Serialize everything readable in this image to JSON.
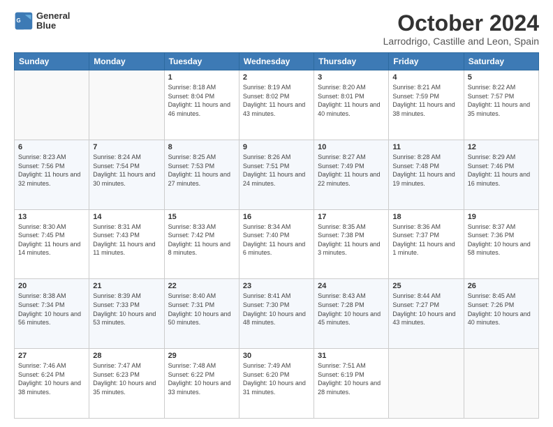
{
  "logo": {
    "line1": "General",
    "line2": "Blue"
  },
  "title": "October 2024",
  "subtitle": "Larrodrigo, Castille and Leon, Spain",
  "days_of_week": [
    "Sunday",
    "Monday",
    "Tuesday",
    "Wednesday",
    "Thursday",
    "Friday",
    "Saturday"
  ],
  "weeks": [
    [
      {
        "day": "",
        "sunrise": "",
        "sunset": "",
        "daylight": ""
      },
      {
        "day": "",
        "sunrise": "",
        "sunset": "",
        "daylight": ""
      },
      {
        "day": "1",
        "sunrise": "Sunrise: 8:18 AM",
        "sunset": "Sunset: 8:04 PM",
        "daylight": "Daylight: 11 hours and 46 minutes."
      },
      {
        "day": "2",
        "sunrise": "Sunrise: 8:19 AM",
        "sunset": "Sunset: 8:02 PM",
        "daylight": "Daylight: 11 hours and 43 minutes."
      },
      {
        "day": "3",
        "sunrise": "Sunrise: 8:20 AM",
        "sunset": "Sunset: 8:01 PM",
        "daylight": "Daylight: 11 hours and 40 minutes."
      },
      {
        "day": "4",
        "sunrise": "Sunrise: 8:21 AM",
        "sunset": "Sunset: 7:59 PM",
        "daylight": "Daylight: 11 hours and 38 minutes."
      },
      {
        "day": "5",
        "sunrise": "Sunrise: 8:22 AM",
        "sunset": "Sunset: 7:57 PM",
        "daylight": "Daylight: 11 hours and 35 minutes."
      }
    ],
    [
      {
        "day": "6",
        "sunrise": "Sunrise: 8:23 AM",
        "sunset": "Sunset: 7:56 PM",
        "daylight": "Daylight: 11 hours and 32 minutes."
      },
      {
        "day": "7",
        "sunrise": "Sunrise: 8:24 AM",
        "sunset": "Sunset: 7:54 PM",
        "daylight": "Daylight: 11 hours and 30 minutes."
      },
      {
        "day": "8",
        "sunrise": "Sunrise: 8:25 AM",
        "sunset": "Sunset: 7:53 PM",
        "daylight": "Daylight: 11 hours and 27 minutes."
      },
      {
        "day": "9",
        "sunrise": "Sunrise: 8:26 AM",
        "sunset": "Sunset: 7:51 PM",
        "daylight": "Daylight: 11 hours and 24 minutes."
      },
      {
        "day": "10",
        "sunrise": "Sunrise: 8:27 AM",
        "sunset": "Sunset: 7:49 PM",
        "daylight": "Daylight: 11 hours and 22 minutes."
      },
      {
        "day": "11",
        "sunrise": "Sunrise: 8:28 AM",
        "sunset": "Sunset: 7:48 PM",
        "daylight": "Daylight: 11 hours and 19 minutes."
      },
      {
        "day": "12",
        "sunrise": "Sunrise: 8:29 AM",
        "sunset": "Sunset: 7:46 PM",
        "daylight": "Daylight: 11 hours and 16 minutes."
      }
    ],
    [
      {
        "day": "13",
        "sunrise": "Sunrise: 8:30 AM",
        "sunset": "Sunset: 7:45 PM",
        "daylight": "Daylight: 11 hours and 14 minutes."
      },
      {
        "day": "14",
        "sunrise": "Sunrise: 8:31 AM",
        "sunset": "Sunset: 7:43 PM",
        "daylight": "Daylight: 11 hours and 11 minutes."
      },
      {
        "day": "15",
        "sunrise": "Sunrise: 8:33 AM",
        "sunset": "Sunset: 7:42 PM",
        "daylight": "Daylight: 11 hours and 8 minutes."
      },
      {
        "day": "16",
        "sunrise": "Sunrise: 8:34 AM",
        "sunset": "Sunset: 7:40 PM",
        "daylight": "Daylight: 11 hours and 6 minutes."
      },
      {
        "day": "17",
        "sunrise": "Sunrise: 8:35 AM",
        "sunset": "Sunset: 7:38 PM",
        "daylight": "Daylight: 11 hours and 3 minutes."
      },
      {
        "day": "18",
        "sunrise": "Sunrise: 8:36 AM",
        "sunset": "Sunset: 7:37 PM",
        "daylight": "Daylight: 11 hours and 1 minute."
      },
      {
        "day": "19",
        "sunrise": "Sunrise: 8:37 AM",
        "sunset": "Sunset: 7:36 PM",
        "daylight": "Daylight: 10 hours and 58 minutes."
      }
    ],
    [
      {
        "day": "20",
        "sunrise": "Sunrise: 8:38 AM",
        "sunset": "Sunset: 7:34 PM",
        "daylight": "Daylight: 10 hours and 56 minutes."
      },
      {
        "day": "21",
        "sunrise": "Sunrise: 8:39 AM",
        "sunset": "Sunset: 7:33 PM",
        "daylight": "Daylight: 10 hours and 53 minutes."
      },
      {
        "day": "22",
        "sunrise": "Sunrise: 8:40 AM",
        "sunset": "Sunset: 7:31 PM",
        "daylight": "Daylight: 10 hours and 50 minutes."
      },
      {
        "day": "23",
        "sunrise": "Sunrise: 8:41 AM",
        "sunset": "Sunset: 7:30 PM",
        "daylight": "Daylight: 10 hours and 48 minutes."
      },
      {
        "day": "24",
        "sunrise": "Sunrise: 8:43 AM",
        "sunset": "Sunset: 7:28 PM",
        "daylight": "Daylight: 10 hours and 45 minutes."
      },
      {
        "day": "25",
        "sunrise": "Sunrise: 8:44 AM",
        "sunset": "Sunset: 7:27 PM",
        "daylight": "Daylight: 10 hours and 43 minutes."
      },
      {
        "day": "26",
        "sunrise": "Sunrise: 8:45 AM",
        "sunset": "Sunset: 7:26 PM",
        "daylight": "Daylight: 10 hours and 40 minutes."
      }
    ],
    [
      {
        "day": "27",
        "sunrise": "Sunrise: 7:46 AM",
        "sunset": "Sunset: 6:24 PM",
        "daylight": "Daylight: 10 hours and 38 minutes."
      },
      {
        "day": "28",
        "sunrise": "Sunrise: 7:47 AM",
        "sunset": "Sunset: 6:23 PM",
        "daylight": "Daylight: 10 hours and 35 minutes."
      },
      {
        "day": "29",
        "sunrise": "Sunrise: 7:48 AM",
        "sunset": "Sunset: 6:22 PM",
        "daylight": "Daylight: 10 hours and 33 minutes."
      },
      {
        "day": "30",
        "sunrise": "Sunrise: 7:49 AM",
        "sunset": "Sunset: 6:20 PM",
        "daylight": "Daylight: 10 hours and 31 minutes."
      },
      {
        "day": "31",
        "sunrise": "Sunrise: 7:51 AM",
        "sunset": "Sunset: 6:19 PM",
        "daylight": "Daylight: 10 hours and 28 minutes."
      },
      {
        "day": "",
        "sunrise": "",
        "sunset": "",
        "daylight": ""
      },
      {
        "day": "",
        "sunrise": "",
        "sunset": "",
        "daylight": ""
      }
    ]
  ]
}
